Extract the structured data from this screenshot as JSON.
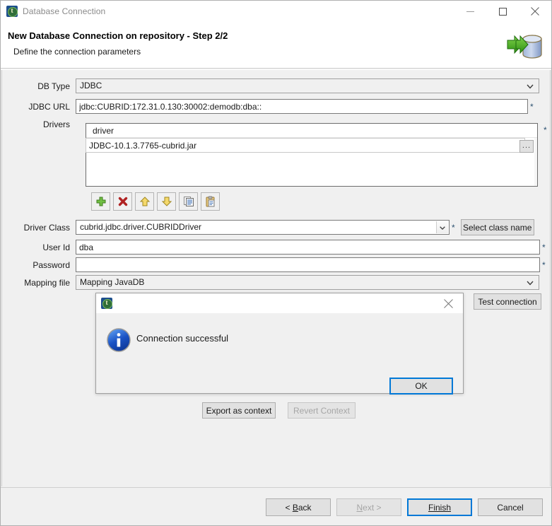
{
  "window": {
    "title": "Database Connection",
    "icon": "talend-icon",
    "controls": {
      "minimize": "minimize-icon",
      "maximize": "maximize-icon",
      "close": "close-icon"
    }
  },
  "header": {
    "title": "New Database Connection on repository - Step 2/2",
    "subtitle": "Define the connection parameters",
    "banner_icon": "database-import-icon"
  },
  "form": {
    "db_type": {
      "label": "DB Type",
      "value": "JDBC"
    },
    "jdbc_url": {
      "label": "JDBC URL",
      "value": "jdbc:CUBRID:172.31.0.130:30002:demodb:dba::",
      "required": "*"
    },
    "drivers": {
      "label": "Drivers",
      "column_header": "driver",
      "rows": [
        "JDBC-10.1.3.7765-cubrid.jar"
      ],
      "browse_label": "...",
      "required": "*"
    },
    "driver_toolbar": [
      {
        "name": "add-driver-button",
        "icon": "green-plus-icon"
      },
      {
        "name": "remove-driver-button",
        "icon": "red-x-icon"
      },
      {
        "name": "move-up-button",
        "icon": "up-arrow-icon"
      },
      {
        "name": "move-down-button",
        "icon": "down-arrow-icon"
      },
      {
        "name": "copy-button",
        "icon": "copy-icon"
      },
      {
        "name": "paste-button",
        "icon": "paste-icon"
      }
    ],
    "driver_class": {
      "label": "Driver Class",
      "value": "cubrid.jdbc.driver.CUBRIDDriver",
      "required": "*"
    },
    "select_class_name": "Select class name",
    "user_id": {
      "label": "User Id",
      "value": "dba",
      "required": "*"
    },
    "password": {
      "label": "Password",
      "value": "",
      "required": "*"
    },
    "mapping_file": {
      "label": "Mapping file",
      "value": "Mapping JavaDB"
    },
    "test_connection": "Test connection",
    "export_as_context": "Export as context",
    "revert_context": "Revert Context"
  },
  "dialog": {
    "icon": "talend-icon",
    "close": "close-icon",
    "message_icon": "info-icon",
    "message": "Connection successful",
    "ok": "OK"
  },
  "wizard_buttons": {
    "back": "< Back",
    "next": "Next >",
    "finish": "Finish",
    "cancel": "Cancel"
  },
  "colors": {
    "focus_blue": "#0078d7",
    "required_mark": "#2b5070",
    "window_bg": "#f0f0f0",
    "header_bg": "#ffffff"
  }
}
